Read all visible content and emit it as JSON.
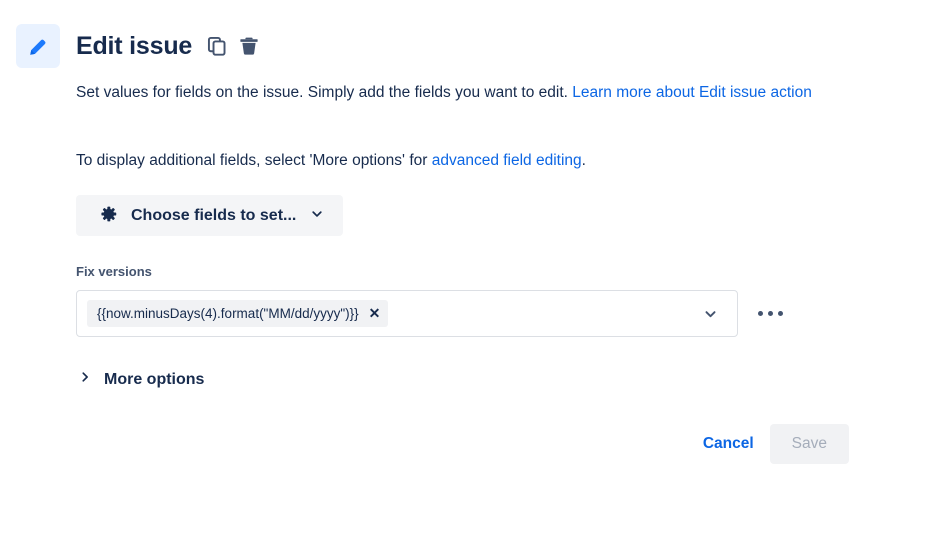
{
  "header": {
    "icon": "pencil-icon",
    "title": "Edit issue",
    "duplicate_icon": "duplicate-icon",
    "delete_icon": "trash-icon"
  },
  "description": {
    "paragraph1_before": "Set values for fields on the issue. Simply add the fields you want to edit. ",
    "paragraph1_link": "Learn more about Edit issue action",
    "paragraph2_before": "To display additional fields, select 'More options' for ",
    "paragraph2_link": "advanced field editing",
    "paragraph2_after": "."
  },
  "choose_fields": {
    "icon": "gear-icon",
    "label": "Choose fields to set...",
    "chevron": "chevron-down-icon"
  },
  "field": {
    "label": "Fix versions",
    "chip_value": "{{now.minusDays(4).format(\"MM/dd/yyyy\")}}",
    "chip_remove": "✕",
    "chevron": "chevron-down-icon",
    "more_menu": "more-options-icon"
  },
  "more_options": {
    "chevron": "chevron-right-icon",
    "label": "More options"
  },
  "footer": {
    "cancel_label": "Cancel",
    "save_label": "Save"
  },
  "colors": {
    "link": "#0C66E4",
    "title": "#172B4D",
    "icon_tile_bg": "#E9F2FF",
    "pencil": "#1D7AFC",
    "icon_gray": "#44546F",
    "chip_bg": "#F1F2F4",
    "button_bg": "#F4F5F7",
    "disabled_text": "#A5ADBA",
    "field_border": "#DCDFE4"
  }
}
